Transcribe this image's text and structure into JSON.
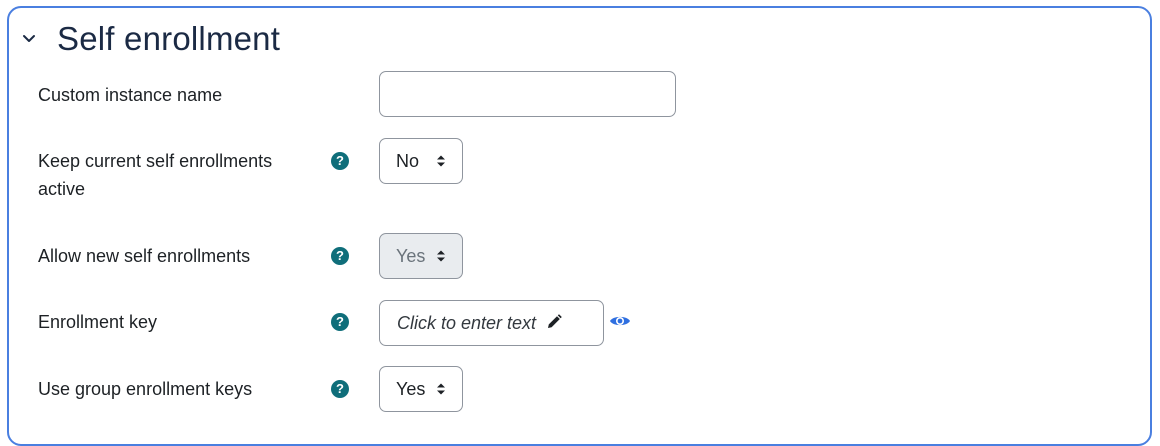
{
  "section": {
    "title": "Self enrollment"
  },
  "fields": {
    "custom_instance_name": {
      "label": "Custom instance name",
      "value": ""
    },
    "keep_current": {
      "label": "Keep current self enrollments active",
      "value": "No"
    },
    "allow_new": {
      "label": "Allow new self enrollments",
      "value": "Yes"
    },
    "enrollment_key": {
      "label": "Enrollment key",
      "placeholder": "Click to enter text"
    },
    "group_keys": {
      "label": "Use group enrollment keys",
      "value": "Yes"
    }
  },
  "colors": {
    "accent": "#4a7fe0",
    "help": "#0f6e7a",
    "eye": "#2f6fe0"
  },
  "icons": [
    "chevron-down-icon",
    "help-icon",
    "pencil-icon",
    "eye-icon",
    "select-caret-icon"
  ]
}
